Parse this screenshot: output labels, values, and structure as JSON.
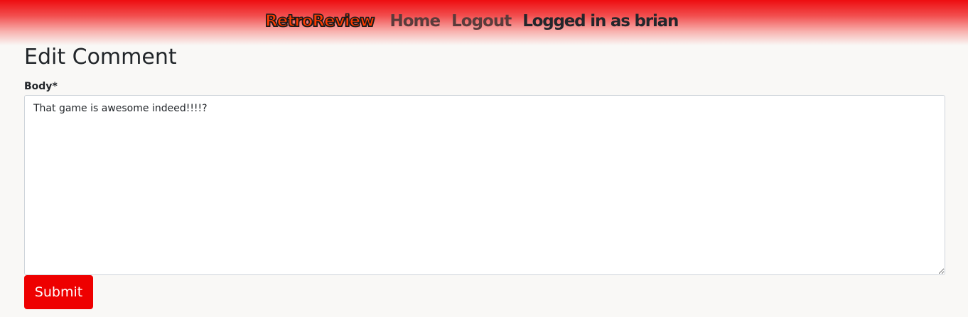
{
  "navbar": {
    "brand": "RetroReview",
    "links": [
      {
        "label": "Home"
      },
      {
        "label": "Logout"
      }
    ],
    "user_status": "Logged in as brian"
  },
  "page": {
    "title": "Edit Comment"
  },
  "form": {
    "body_label": "Body",
    "required_marker": "*",
    "body_value": "That game is awesome indeed!!!!?",
    "submit_label": "Submit"
  },
  "colors": {
    "navbar_gradient_top": "#ee0d10",
    "brand_fill": "#ff3a00",
    "submit_button": "#ee0000",
    "page_background": "#f9f8f6"
  }
}
